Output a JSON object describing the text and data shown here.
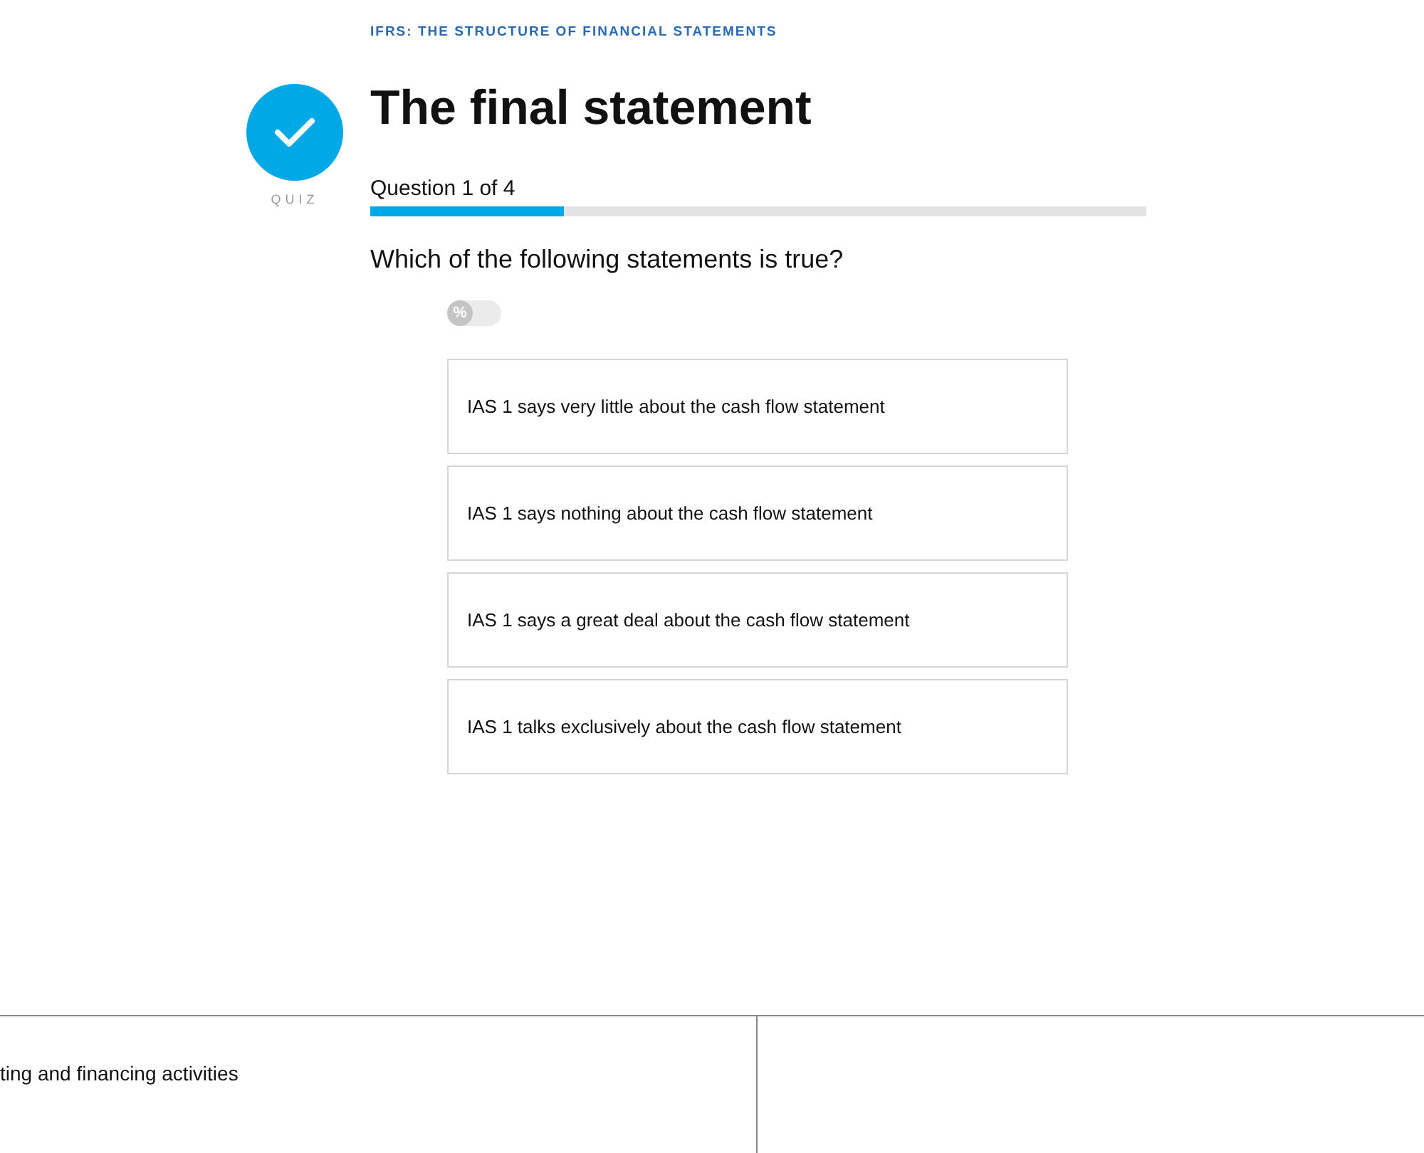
{
  "course_title": "IFRS: THE STRUCTURE OF FINANCIAL STATEMENTS",
  "badge_label": "QUIZ",
  "title": "The final statement",
  "progress": {
    "label": "Question 1 of 4",
    "level": 0.25
  },
  "question": "Which of the following statements is true?",
  "percent_toggle": {
    "label": "%",
    "on": false
  },
  "options": [
    {
      "text": "IAS 1 says very little about the cash flow statement",
      "selected": false
    },
    {
      "text": "IAS 1 says nothing about the cash flow statement",
      "selected": false
    },
    {
      "text": "IAS 1 says a great deal about the cash flow statement",
      "selected": false
    },
    {
      "text": "IAS 1 talks exclusively about the cash flow statement",
      "selected": false
    }
  ],
  "table": {
    "rows": [
      [
        "ting and financing activities",
        ""
      ]
    ]
  }
}
